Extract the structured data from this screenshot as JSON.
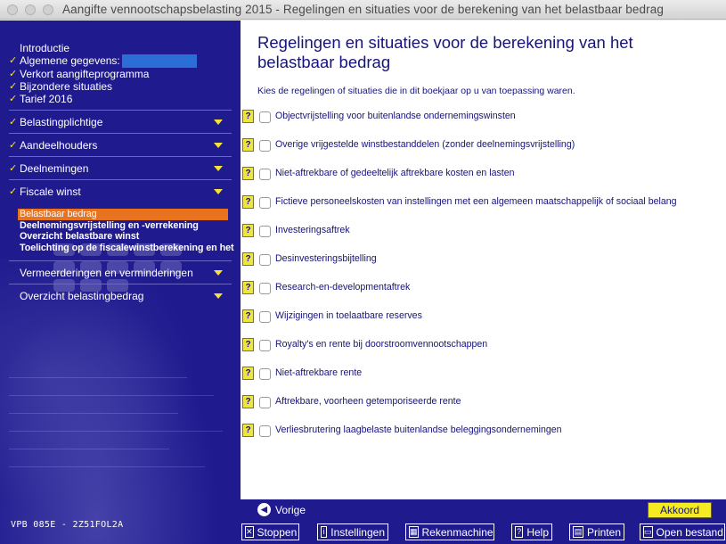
{
  "window": {
    "title": "Aangifte vennootschapsbelasting 2015 - Regelingen en situaties voor de berekening van het belastbaar bedrag"
  },
  "sidebar": {
    "top_items": [
      {
        "label": "Introductie",
        "checked": false
      },
      {
        "label": "Algemene gegevens:",
        "checked": true
      },
      {
        "label": "Verkort aangifteprogramma",
        "checked": true
      },
      {
        "label": "Bijzondere situaties",
        "checked": true
      },
      {
        "label": "Tarief 2016",
        "checked": true
      }
    ],
    "sections": [
      {
        "label": "Belastingplichtige",
        "checked": true
      },
      {
        "label": "Aandeelhouders",
        "checked": true
      },
      {
        "label": "Deelnemingen",
        "checked": true
      },
      {
        "label": "Fiscale winst",
        "checked": true
      },
      {
        "label": "Vermeerderingen en verminderingen",
        "checked": false
      },
      {
        "label": "Overzicht belastingbedrag",
        "checked": false
      }
    ],
    "sub_items": [
      {
        "label": "Belastbaar bedrag",
        "active": true
      },
      {
        "label": "Deelnemingsvrijstelling en -verrekening",
        "active": false
      },
      {
        "label": "Overzicht belastbare winst",
        "active": false
      },
      {
        "label": "Toelichting op de fiscalewinstberekening en het",
        "active": false
      }
    ],
    "version": "VPB 085E - 2Z51FOL2A"
  },
  "main": {
    "title": "Regelingen en situaties voor de berekening van het belastbaar bedrag",
    "intro": "Kies de regelingen of situaties die in dit boekjaar op u van toepassing waren.",
    "help_label": "?",
    "options": [
      "Objectvrijstelling voor buitenlandse ondernemingswinsten",
      "Overige vrijgestelde winstbestanddelen (zonder deelnemingsvrijstelling)",
      "Niet-aftrekbare of gedeeltelijk aftrekbare kosten en lasten",
      "Fictieve personeelskosten van instellingen met een algemeen maatschappelijk of sociaal belang",
      "Investeringsaftrek",
      "Desinvesteringsbijtelling",
      "Research-en-developmentaftrek",
      "Wijzigingen in toelaatbare reserves",
      "Royalty's en rente bij doorstroomvennootschappen",
      "Niet-aftrekbare rente",
      "Aftrekbare, voorheen getemporiseerde rente",
      "Verliesbrutering laagbelaste buitenlandse beleggingsondernemingen"
    ]
  },
  "navigation": {
    "prev_label": "Vorige",
    "accept_label": "Akkoord"
  },
  "toolbar": {
    "stoppen": "Stoppen",
    "instellingen": "Instellingen",
    "rekenmachine": "Rekenmachine",
    "help": "Help",
    "printen": "Printen",
    "open_bestand": "Open bestand"
  }
}
